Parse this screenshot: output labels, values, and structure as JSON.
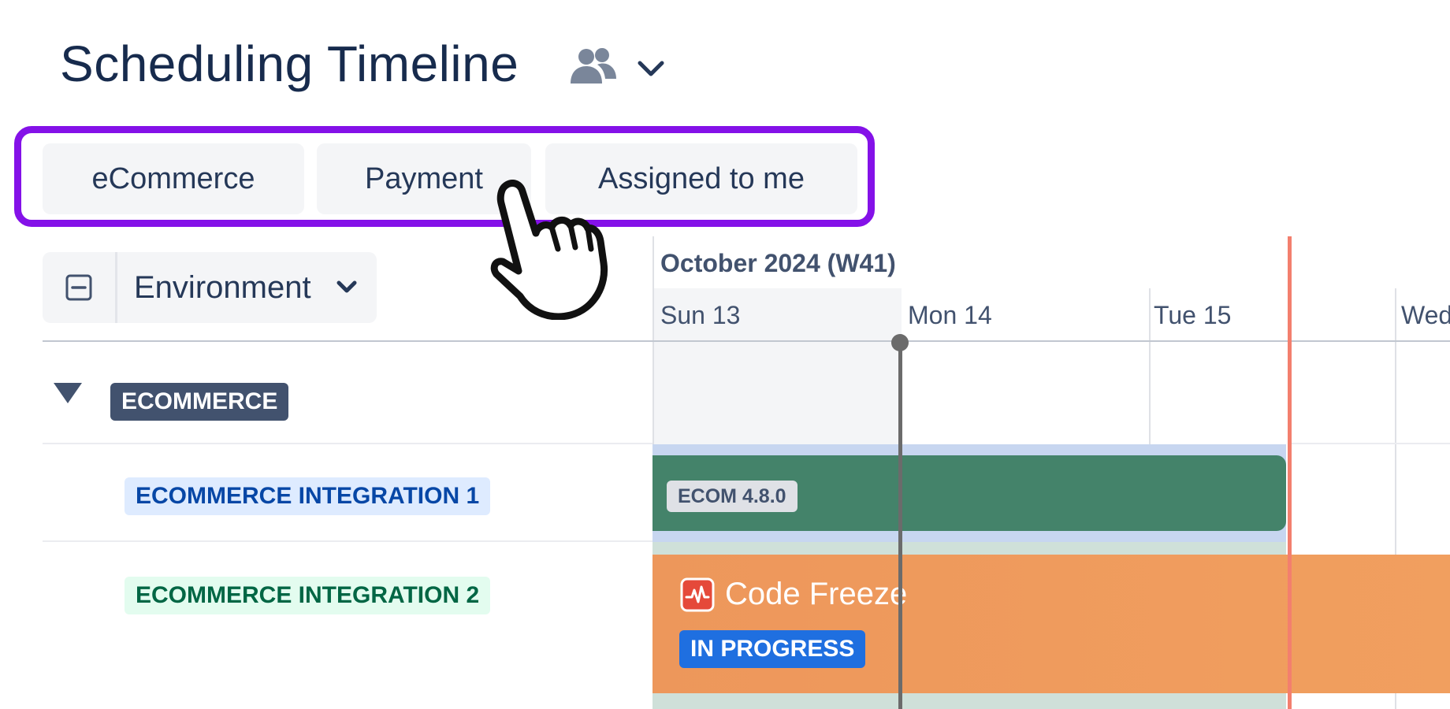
{
  "header": {
    "title": "Scheduling Timeline",
    "share_icon": "people-icon",
    "dropdown_icon": "chevron-down-icon"
  },
  "quick_filters": [
    {
      "label": "eCommerce"
    },
    {
      "label": "Payment"
    },
    {
      "label": "Assigned to me"
    }
  ],
  "grouping": {
    "collapse_icon": "collapse-all-icon",
    "label": "Environment",
    "chevron_icon": "chevron-down-icon"
  },
  "timeline": {
    "period": "October 2024 (W41)",
    "days": [
      "Sun 13",
      "Mon 14",
      "Tue 15",
      "Wed"
    ]
  },
  "groups": [
    {
      "name": "ECOMMERCE",
      "expanded": true,
      "environments": [
        {
          "name": "ECOMMERCE INTEGRATION 1",
          "release": "ECOM 4.8.0"
        },
        {
          "name": "ECOMMERCE INTEGRATION 2",
          "event": "Code Freeze",
          "status": "IN PROGRESS"
        }
      ]
    }
  ],
  "colors": {
    "accent_highlight": "#8411e8",
    "release_bar": "#44836a",
    "event_bar": "#ed975b",
    "status_blue": "#1f6fe0",
    "now_line": "#f37f6e",
    "today_line": "#6b6b6b"
  },
  "cursor": "hand-pointer-icon"
}
